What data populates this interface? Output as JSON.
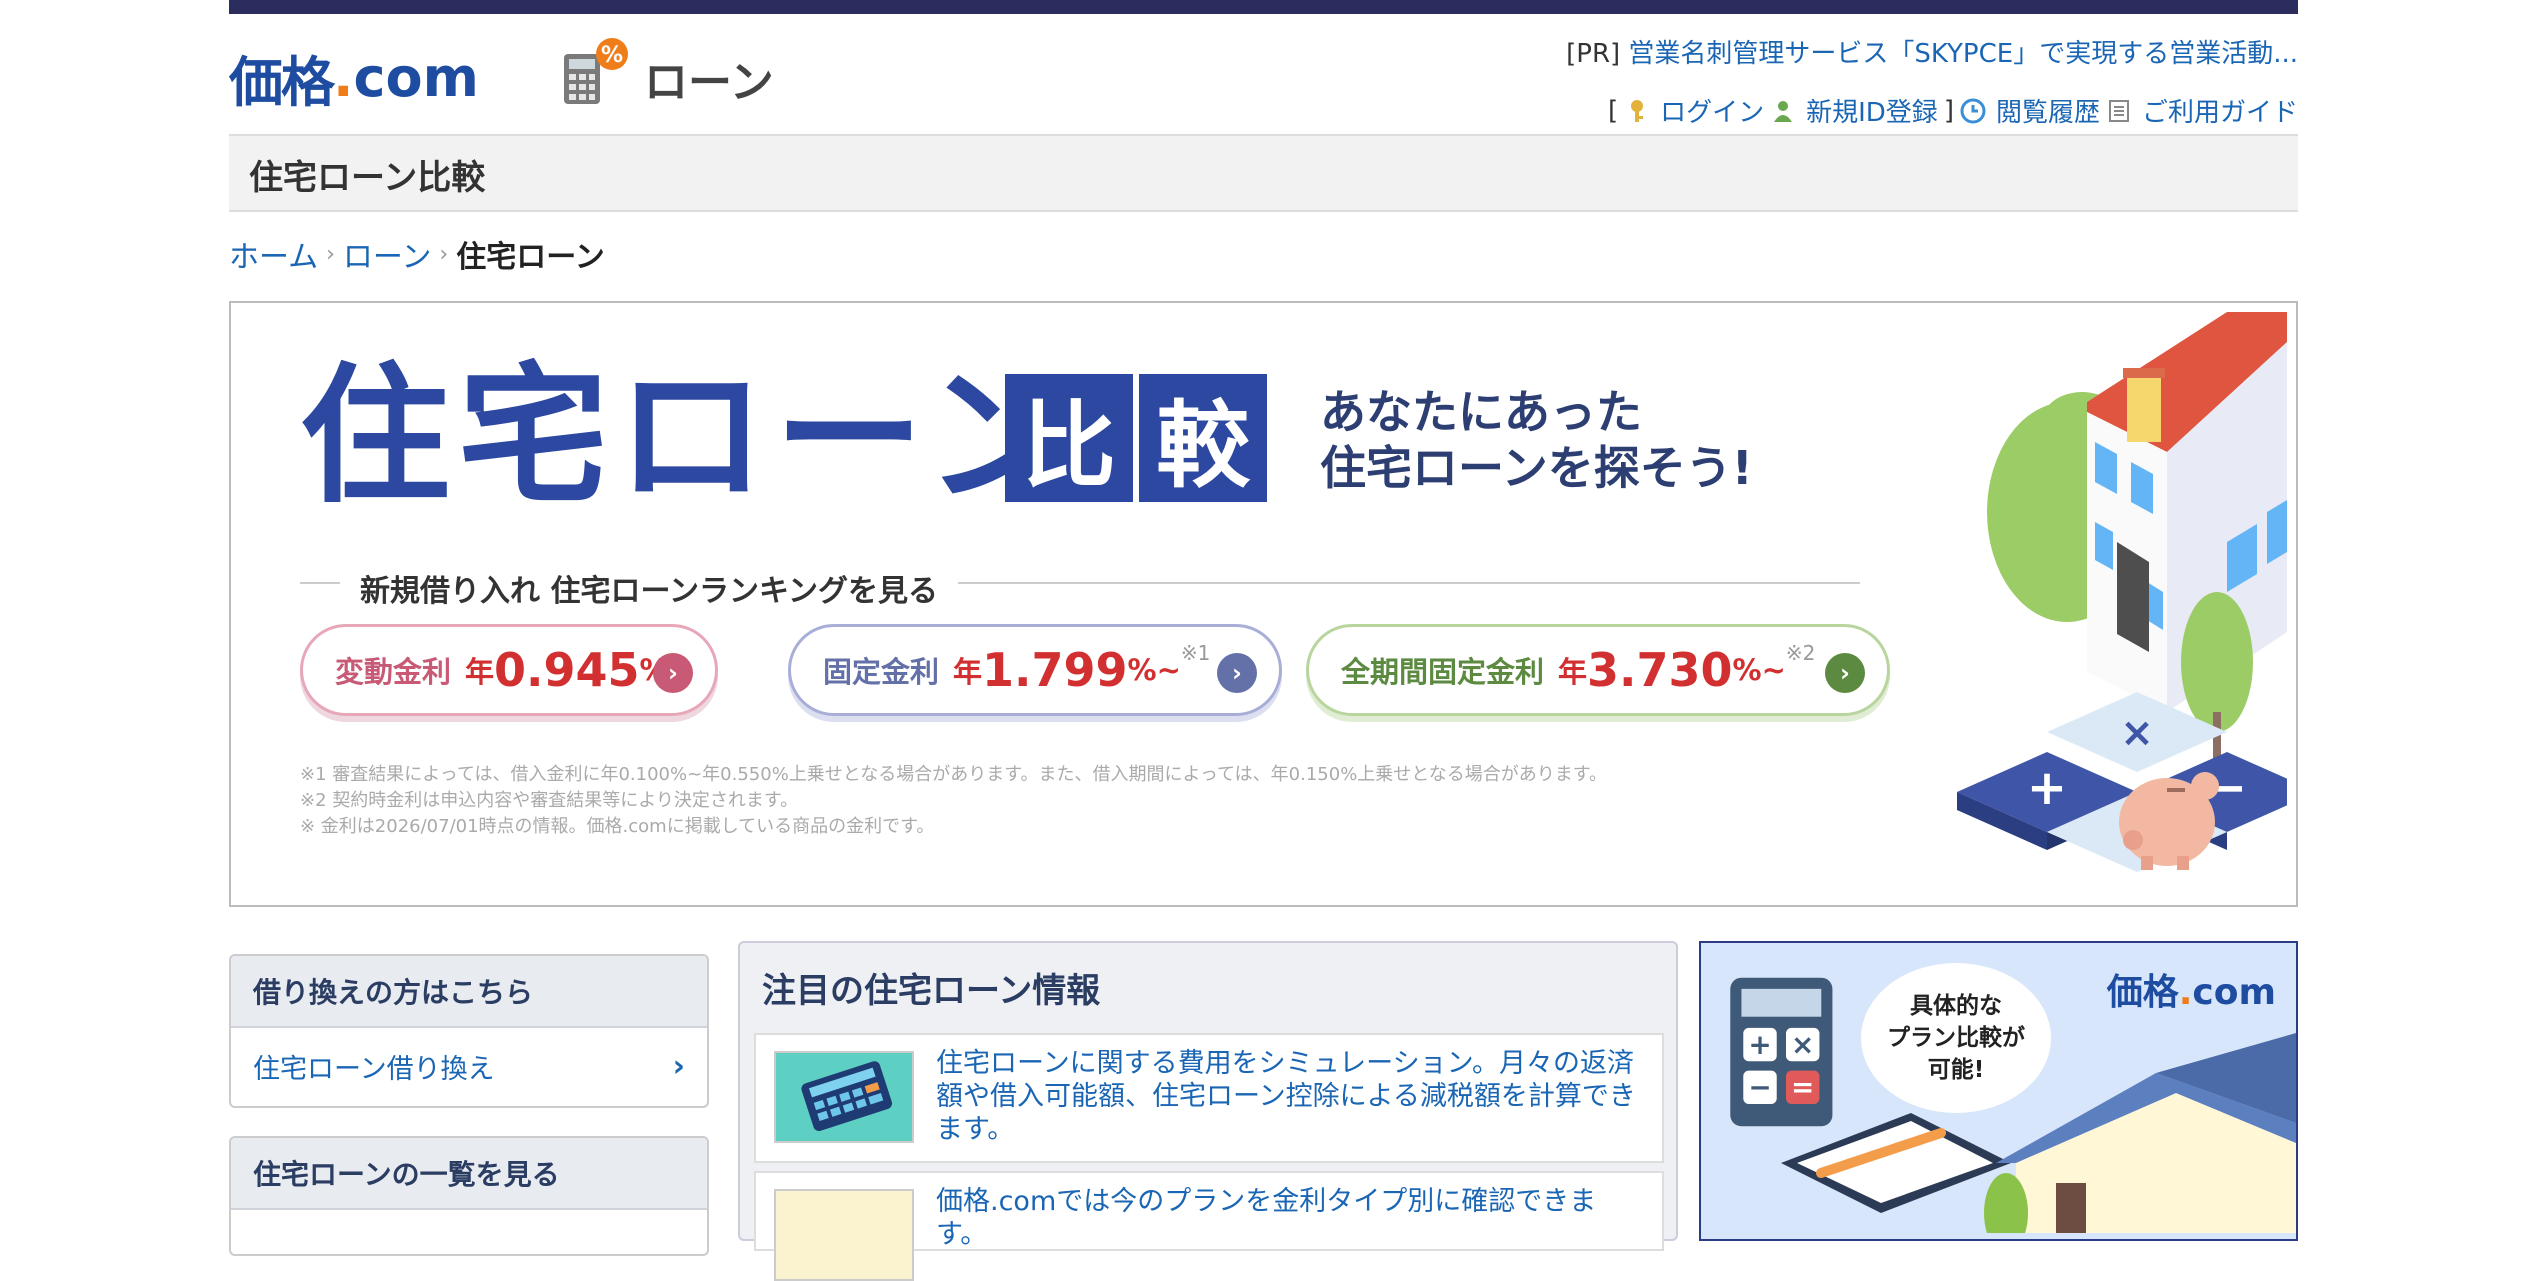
{
  "header": {
    "site_logo": {
      "name": "価格",
      "dot": ".",
      "suffix": "com"
    },
    "section_label": "ローン",
    "pr": {
      "prefix": "[PR]",
      "link_text": "営業名刺管理サービス「SKYPCE」で実現する営業活動..."
    },
    "user_nav": {
      "bracket_open": "[",
      "login": "ログイン",
      "register": "新規ID登録",
      "bracket_close": "]",
      "history": "閲覧履歴",
      "guide": "ご利用ガイド"
    }
  },
  "page_title": "住宅ローン比較",
  "breadcrumb": {
    "items": [
      "ホーム",
      "ローン"
    ],
    "current": "住宅ローン",
    "separator": "›"
  },
  "banner": {
    "title": "住宅ローン",
    "title_box_1": "比",
    "title_box_2": "較",
    "tagline_1": "あなたにあった",
    "tagline_2": "住宅ローンを探そう!",
    "ranking_label": "新規借り入れ 住宅ローンランキングを見る",
    "rates": [
      {
        "label": "変動金利",
        "prefix": "年",
        "value": "0.945",
        "unit": "%~",
        "note": ""
      },
      {
        "label": "固定金利",
        "prefix": "年",
        "value": "1.799",
        "unit": "%~",
        "note": "※1"
      },
      {
        "label": "全期間固定金利",
        "prefix": "年",
        "value": "3.730",
        "unit": "%~",
        "note": "※2"
      }
    ],
    "footnotes": [
      "※1 審査結果によっては、借入金利に年0.100%~年0.550%上乗せとなる場合があります。また、借入期間によっては、年0.150%上乗せとなる場合があります。",
      "※2 契約時金利は申込内容や審査結果等により決定されます。",
      "※ 金利は2026/07/01時点の情報。価格.comに掲載している商品の金利です。"
    ]
  },
  "sidebar": {
    "refinance": {
      "heading": "借り換えの方はこちら",
      "link": "住宅ローン借り換え"
    },
    "list": {
      "heading": "住宅ローンの一覧を見る"
    }
  },
  "news": {
    "heading": "注目の住宅ローン情報",
    "items": [
      {
        "text": "住宅ローンに関する費用をシミュレーション。月々の返済額や借入可能額、住宅ローン控除による減税額を計算できます。"
      },
      {
        "text": "価格.comでは今のプランを金利タイプ別に確認できます。"
      }
    ]
  },
  "ad": {
    "logo": {
      "name": "価格",
      "dot": ".",
      "suffix": "com"
    },
    "bubble_1": "具体的な",
    "bubble_2": "プラン比較が",
    "bubble_3": "可能!"
  },
  "colors": {
    "brand": "#1e4ca0",
    "brand_orange": "#ef7d1a",
    "link": "#1a66b4",
    "rate_red": "#d23030",
    "topbar": "#2a2d5e"
  }
}
